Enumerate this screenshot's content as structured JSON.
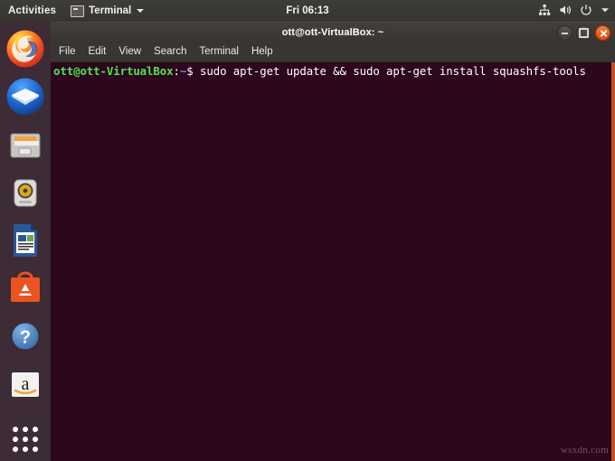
{
  "topbar": {
    "activities": "Activities",
    "app_menu": "Terminal",
    "app_menu_icon": "terminal-icon",
    "clock": "Fri 06:13",
    "indicators": [
      {
        "name": "network-icon",
        "label": "Network"
      },
      {
        "name": "volume-icon",
        "label": "Volume"
      },
      {
        "name": "power-icon",
        "label": "Power"
      },
      {
        "name": "chevron-down-icon",
        "label": "System menu"
      }
    ]
  },
  "launcher": {
    "items": [
      {
        "name": "firefox",
        "label": "Firefox Web Browser"
      },
      {
        "name": "thunderbird",
        "label": "Thunderbird Mail"
      },
      {
        "name": "files",
        "label": "Files"
      },
      {
        "name": "rhythmbox",
        "label": "Rhythmbox"
      },
      {
        "name": "libreoffice-writer",
        "label": "LibreOffice Writer"
      },
      {
        "name": "ubuntu-software",
        "label": "Ubuntu Software"
      },
      {
        "name": "help",
        "label": "Help"
      },
      {
        "name": "amazon",
        "label": "Amazon"
      },
      {
        "name": "show-applications",
        "label": "Show Applications"
      }
    ]
  },
  "terminal": {
    "title": "ott@ott-VirtualBox: ~",
    "menu": [
      "File",
      "Edit",
      "View",
      "Search",
      "Terminal",
      "Help"
    ],
    "window_buttons": {
      "minimize": "Minimize",
      "maximize": "Maximize",
      "close": "Close"
    },
    "prompt": {
      "user_host": "ott@ott-VirtualBox",
      "colon": ":",
      "path": "~",
      "sigil": "$"
    },
    "command": "sudo apt-get update && sudo apt-get install squashfs-tools",
    "colors": {
      "background": "#2c071e",
      "prompt_user": "#4fe44f",
      "prompt_path": "#6a8fe8",
      "text": "#ffffff",
      "border_accent": "#c4502a"
    }
  },
  "watermark": "wsxdn.com"
}
